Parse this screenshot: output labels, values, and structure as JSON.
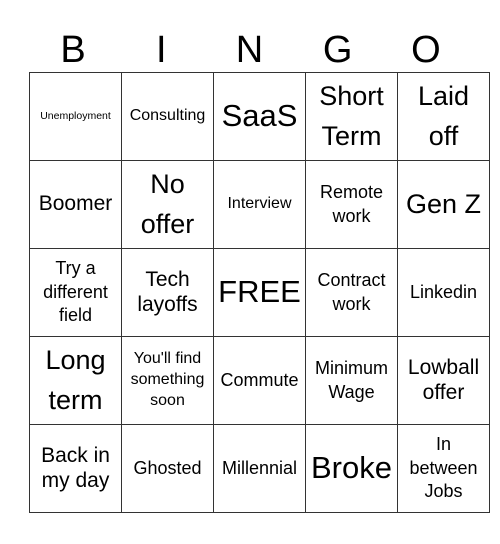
{
  "header": [
    "B",
    "I",
    "N",
    "G",
    "O"
  ],
  "cells": [
    [
      "Unemployment",
      "Consulting",
      "SaaS",
      "Short Term",
      "Laid off"
    ],
    [
      "Boomer",
      "No offer",
      "Interview",
      "Remote work",
      "Gen Z"
    ],
    [
      "Try a different field",
      "Tech layoffs",
      "FREE",
      "Contract work",
      "Linkedin"
    ],
    [
      "Long term",
      "You'll find something soon",
      "Commute",
      "Minimum Wage",
      "Lowball offer"
    ],
    [
      "Back in my day",
      "Ghosted",
      "Millennial",
      "Broke",
      "In between Jobs"
    ]
  ]
}
